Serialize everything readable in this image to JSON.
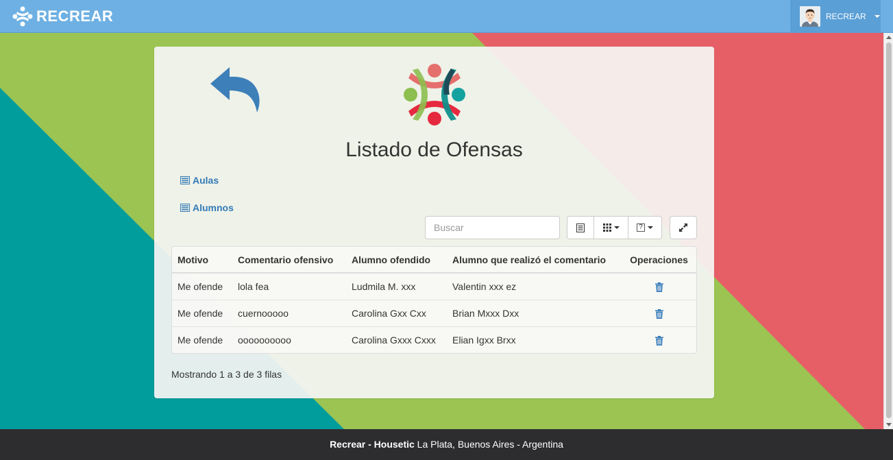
{
  "navbar": {
    "brand": "RECREAR",
    "user_label": "RECREAR"
  },
  "page": {
    "title": "Listado de Ofensas",
    "links": {
      "aulas": "Aulas",
      "alumnos": "Alumnos"
    }
  },
  "toolbar": {
    "search_placeholder": "Buscar",
    "buttons": [
      "toggle-view-icon",
      "columns-icon",
      "export-icon",
      "fullscreen-icon"
    ]
  },
  "table": {
    "headers": [
      "Motivo",
      "Comentario ofensivo",
      "Alumno ofendido",
      "Alumno que realizó el comentario",
      "Operaciones"
    ],
    "rows": [
      [
        "Me ofende",
        "lola fea",
        "Ludmila M. xxx",
        "Valentin xxx ez"
      ],
      [
        "Me ofende",
        "cuernooooo",
        "Carolina Gxx Cxx",
        "Brian Mxxx Dxx"
      ],
      [
        "Me ofende",
        "oooooooooo",
        "Carolina Gxxx Cxxx",
        "Elian Igxx Brxx"
      ]
    ],
    "pagination_info": "Mostrando 1 a 3 de 3 filas"
  },
  "footer": {
    "brand": "Recrear - Housetic",
    "location": " La Plata, Buenos Aires - Argentina"
  },
  "colors": {
    "navbar": "#6eb0e3",
    "green": "#9bc453",
    "red": "#e65f67",
    "teal": "#019c9c",
    "footer": "#2d2d2f",
    "link": "#337ab7"
  }
}
